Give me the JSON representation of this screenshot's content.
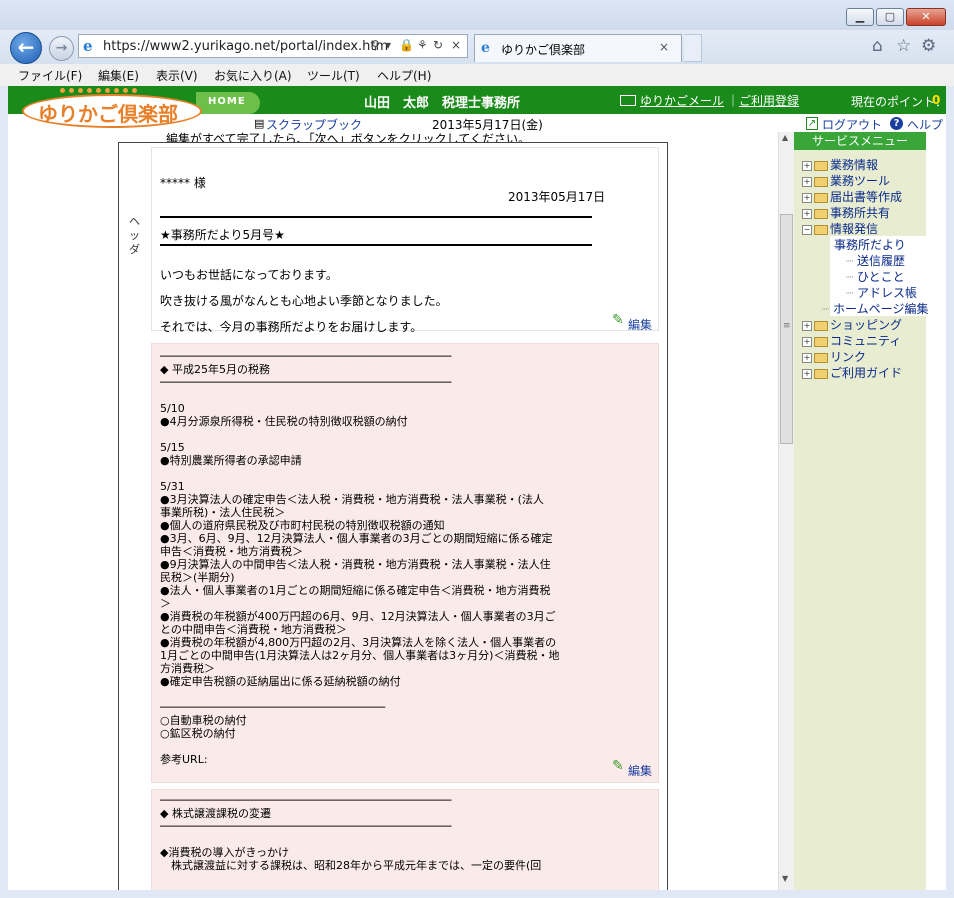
{
  "browser": {
    "url": "https://www2.yurikago.net/portal/index.htm",
    "tab_title": "ゆりかご倶楽部",
    "tab_close": "×",
    "addr_icons": [
      "⚲",
      "▾",
      "🔒",
      "⚘",
      "↻",
      "×"
    ],
    "menu": [
      "ファイル(F)",
      "編集(E)",
      "表示(V)",
      "お気に入り(A)",
      "ツール(T)",
      "ヘルプ(H)"
    ],
    "window_min": "▁",
    "window_max": "▢",
    "window_close": "✕"
  },
  "site": {
    "logo_text": "ゆりかご倶楽部",
    "home_label": "HOME",
    "office_name": "山田　太郎　税理士事務所",
    "mail_link": "ゆりかごメール",
    "separator": "｜",
    "register_link": "ご利用登録",
    "points_label": "現在のポイント：",
    "points_value": "0",
    "scrapbook_link": "スクラップブック",
    "date": "2013年5月17日(金)",
    "logout_link": "ログアウト",
    "help_link": "ヘルプ"
  },
  "editor": {
    "instruction": "編集がすべて完了したら、「次へ」ボタンをクリックしてください。",
    "side_label": "ヘッダ",
    "edit_label": "編集",
    "header_block": {
      "recipient": "***** 様",
      "date": "2013年05月17日",
      "title": "★事務所だより5月号★",
      "line1": "いつもお世話になっております。",
      "line2": "吹き抜ける風がなんとも心地よい季節となりました。",
      "line3": "それでは、今月の事務所だよりをお届けします。"
    },
    "tax_block_lines": [
      "────────────────────────────────────────────",
      "◆ 平成25年5月の税務",
      "────────────────────────────────────────────",
      "",
      "5/10",
      "●4月分源泉所得税・住民税の特別徴収税額の納付",
      "",
      "5/15",
      "●特別農業所得者の承認申請",
      "",
      "5/31",
      "●3月決算法人の確定申告＜法人税・消費税・地方消費税・法人事業税・(法人",
      "事業所税)・法人住民税＞",
      "●個人の道府県民税及び市町村民税の特別徴収税額の通知",
      "●3月、6月、9月、12月決算法人・個人事業者の3月ごとの期間短縮に係る確定",
      "申告＜消費税・地方消費税＞",
      "●9月決算法人の中間申告＜法人税・消費税・地方消費税・法人事業税・法人住",
      "民税＞(半期分)",
      "●法人・個人事業者の1月ごとの期間短縮に係る確定申告＜消費税・地方消費税",
      "＞",
      "●消費税の年税額が400万円超の6月、9月、12月決算法人・個人事業者の3月ご",
      "との中間申告＜消費税・地方消費税＞",
      "●消費税の年税額が4,800万円超の2月、3月決算法人を除く法人・個人事業者の",
      "1月ごとの中間申告(1月決算法人は2ヶ月分、個人事業者は3ヶ月分)＜消費税・地",
      "方消費税＞",
      "●確定申告税額の延納届出に係る延納税額の納付",
      "",
      "──────────────────────────────────",
      "○自動車税の納付",
      "○鉱区税の納付",
      "",
      "参考URL:"
    ],
    "stock_block_lines": [
      "────────────────────────────────────────────",
      "◆ 株式譲渡課税の変遷",
      "────────────────────────────────────────────",
      "",
      "◆消費税の導入がきっかけ",
      "　株式譲渡益に対する課税は、昭和28年から平成元年までは、一定の要件(回"
    ]
  },
  "sidebar": {
    "heading": "サービスメニュー",
    "items": [
      {
        "toggle": "+",
        "label": "業務情報"
      },
      {
        "toggle": "+",
        "label": "業務ツール"
      },
      {
        "toggle": "+",
        "label": "届出書等作成"
      },
      {
        "toggle": "+",
        "label": "事務所共有"
      },
      {
        "toggle": "−",
        "label": "情報発信"
      }
    ],
    "subitems": [
      "事務所だより",
      "送信履歴",
      "ひとこと",
      "アドレス帳",
      "ホームページ編集"
    ],
    "items_after": [
      {
        "toggle": "+",
        "label": "ショッピング"
      },
      {
        "toggle": "+",
        "label": "コミュニティ"
      },
      {
        "toggle": "+",
        "label": "リンク"
      },
      {
        "toggle": "+",
        "label": "ご利用ガイド"
      }
    ]
  },
  "colors": {
    "header_green": "#1a8a1a",
    "logo_orange": "#e8802a",
    "link_blue": "#1a3ea0",
    "pink_block": "#fbeaea",
    "sidebar_bg": "#e8ecd0"
  }
}
